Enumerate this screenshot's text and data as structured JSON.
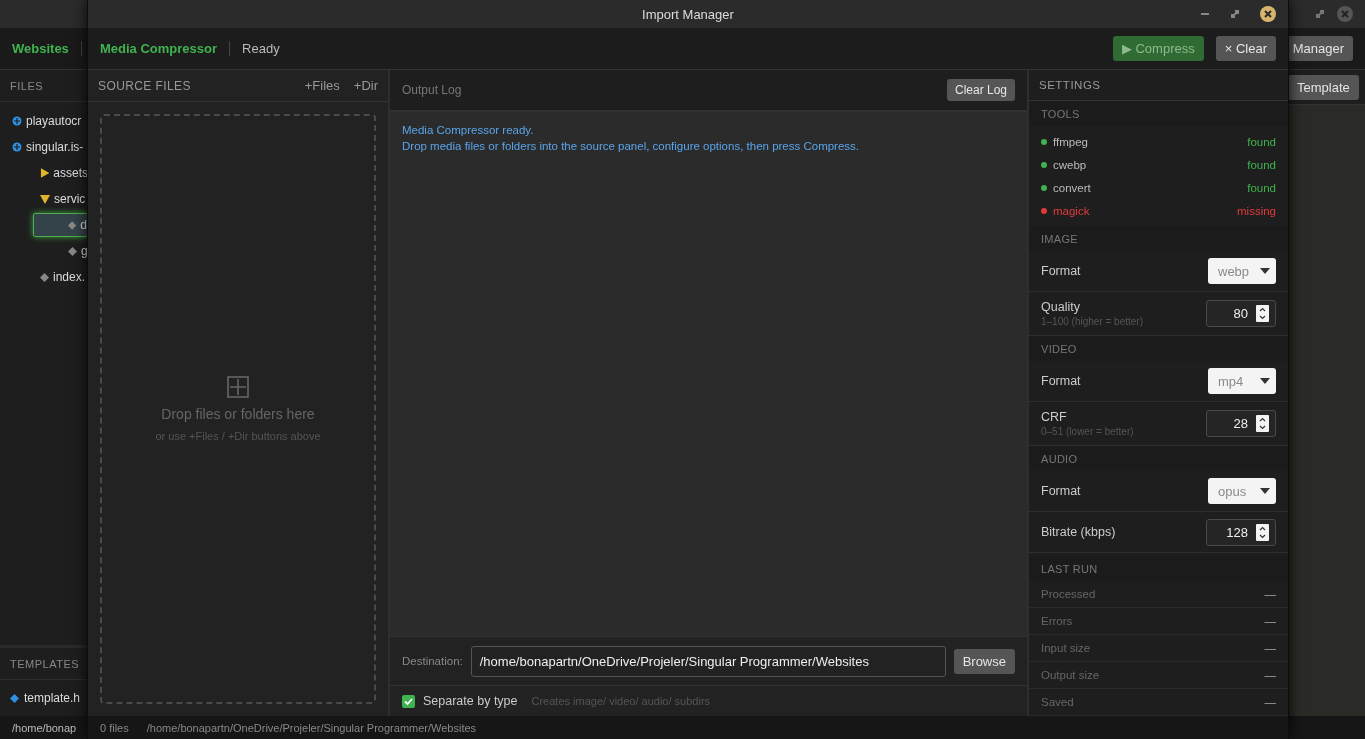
{
  "background_window": {
    "toolbar_title": "Websites",
    "manager_button": "Manager",
    "files_header": "FILES",
    "tree": [
      {
        "label": "playautocr",
        "kind": "site",
        "selected": false
      },
      {
        "label": "singular.is-",
        "kind": "site",
        "selected": false,
        "children": [
          {
            "label": "assets",
            "kind": "folder",
            "expanded": false,
            "selected": false
          },
          {
            "label": "servic",
            "kind": "folder",
            "expanded": true,
            "selected": false,
            "children": [
              {
                "label": "d",
                "kind": "file",
                "selected": true
              },
              {
                "label": "g",
                "kind": "file",
                "selected": false
              }
            ]
          },
          {
            "label": "index.",
            "kind": "file",
            "selected": false
          }
        ]
      }
    ],
    "templates_header": "TEMPLATES",
    "templates": [
      {
        "label": "template.h"
      }
    ],
    "template_button": "Template",
    "status_path": "/home/bonap"
  },
  "dialog": {
    "title": "Import Manager",
    "app_name": "Media Compressor",
    "status": "Ready",
    "compress_button": {
      "label": "▶ Compress",
      "disabled": true
    },
    "clear_button": {
      "label": "× Clear",
      "disabled": false
    },
    "source_panel": {
      "header": "SOURCE FILES",
      "add_files": "+Files",
      "add_dir": "+Dir",
      "drop_title": "Drop files or folders here",
      "drop_hint": "or use +Files / +Dir buttons above"
    },
    "log": {
      "header": "Output Log",
      "clear_button": "Clear Log",
      "lines": [
        "Media Compressor ready.",
        "Drop media files or folders into the source panel, configure options, then press Compress."
      ],
      "destination_label": "Destination:",
      "destination_value": "/home/bonapartn/OneDrive/Projeler/Singular Programmer/Websites",
      "browse_button": "Browse",
      "separate": {
        "label": "Separate by type",
        "checked": true,
        "hint": "Creates image/ video/ audio/ subdirs"
      }
    },
    "settings": {
      "header": "SETTINGS",
      "sections": [
        {
          "title": "TOOLS",
          "kind": "tools",
          "items": [
            {
              "name": "ffmpeg",
              "status": "found",
              "available": true,
              "color": "#3fb34f"
            },
            {
              "name": "cwebp",
              "status": "found",
              "available": true,
              "color": "#3fb34f"
            },
            {
              "name": "convert",
              "status": "found",
              "available": true,
              "color": "#3fb34f"
            },
            {
              "name": "magick",
              "status": "missing",
              "available": false,
              "color": "#e03b3b"
            }
          ]
        },
        {
          "title": "IMAGE",
          "kind": "options",
          "items": [
            {
              "kind": "select",
              "label": "Format",
              "value": "webp"
            },
            {
              "kind": "number",
              "label": "Quality",
              "hint": "1–100 (higher = better)",
              "value": "80"
            }
          ]
        },
        {
          "title": "VIDEO",
          "kind": "options",
          "items": [
            {
              "kind": "select",
              "label": "Format",
              "value": "mp4"
            },
            {
              "kind": "number",
              "label": "CRF",
              "hint": "0–51 (lower = better)",
              "value": "28"
            }
          ]
        },
        {
          "title": "AUDIO",
          "kind": "options",
          "items": [
            {
              "kind": "select",
              "label": "Format",
              "value": "opus"
            },
            {
              "kind": "number",
              "label": "Bitrate (kbps)",
              "value": "128"
            }
          ]
        },
        {
          "title": "LAST RUN",
          "kind": "stats",
          "items": [
            {
              "label": "Processed",
              "value": "—"
            },
            {
              "label": "Errors",
              "value": "—"
            },
            {
              "label": "Input size",
              "value": "—"
            },
            {
              "label": "Output size",
              "value": "—"
            },
            {
              "label": "Saved",
              "value": "—"
            }
          ]
        }
      ]
    },
    "status_bar": {
      "count": "0 files",
      "path": "/home/bonapartn/OneDrive/Projeler/Singular Programmer/Websites"
    }
  }
}
